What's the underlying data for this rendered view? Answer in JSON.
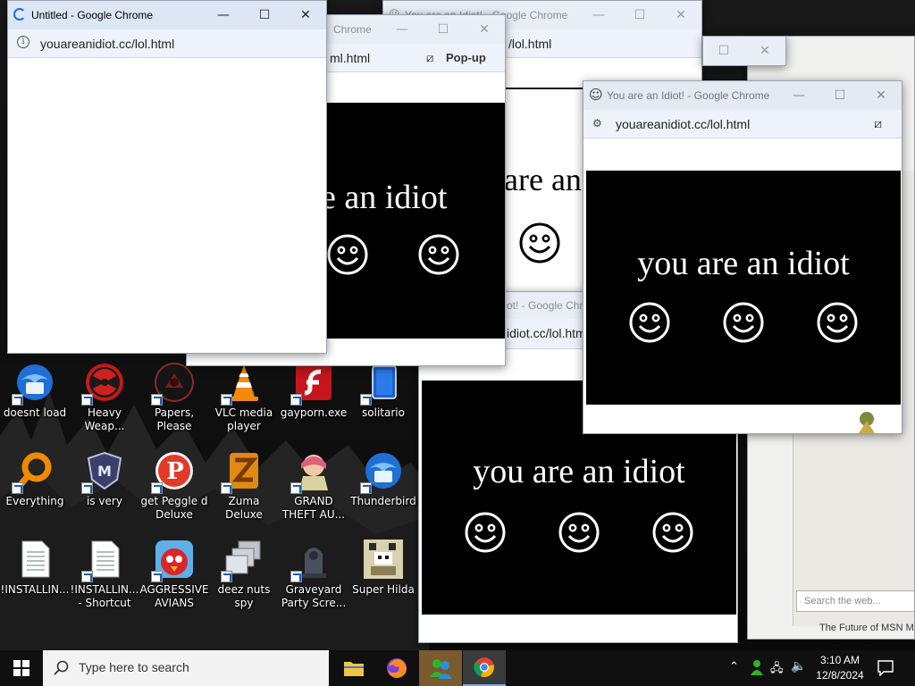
{
  "desktop": {
    "icons": [
      {
        "label": "doesnt load",
        "icon": "thunderbird-icon"
      },
      {
        "label": "Heavy Weap...",
        "icon": "radiation-icon"
      },
      {
        "label": "Papers, Please",
        "icon": "papers-please-icon"
      },
      {
        "label": "VLC media player",
        "icon": "vlc-cone-icon"
      },
      {
        "label": "gayporn.exe",
        "icon": "flash-icon"
      },
      {
        "label": "solitario",
        "icon": "solitaire-icon"
      },
      {
        "label": "Everything",
        "icon": "magnifier-icon"
      },
      {
        "label": "is very",
        "icon": "shield-icon"
      },
      {
        "label": "get Peggle d Deluxe",
        "icon": "peggle-icon"
      },
      {
        "label": "Zuma Deluxe",
        "icon": "zuma-icon"
      },
      {
        "label": "GRAND THEFT AU...",
        "icon": "anime-girl-icon"
      },
      {
        "label": "Thunderbird",
        "icon": "thunderbird-icon"
      },
      {
        "label": "!INSTALLIN...",
        "icon": "document-icon"
      },
      {
        "label": "!INSTALLIN... - Shortcut",
        "icon": "document-icon"
      },
      {
        "label": "AGGRESSIVE AVIANS",
        "icon": "angry-bird-icon"
      },
      {
        "label": "deez nuts spy",
        "icon": "windows-stack-icon"
      },
      {
        "label": "Graveyard Party Scre...",
        "icon": "graveyard-icon"
      },
      {
        "label": "Super Hilda",
        "icon": "pixel-character-icon"
      }
    ]
  },
  "windows": {
    "untitled": {
      "title": "Untitled - Google Chrome",
      "url": "youareanidiot.cc/lol.html"
    },
    "popup1": {
      "title_partial": "Chrome",
      "url_partial": "ml.html",
      "popup_label": "Pop-up",
      "text": "e an idiot"
    },
    "popup_back": {
      "title_partial": "You are an Idiot! - Google Chrome",
      "url_partial": "/lol.html"
    },
    "popup_mid": {
      "text": "are an"
    },
    "popup_front": {
      "title": "You are an Idiot! - Google Chrome",
      "url": "youareanidiot.cc/lol.html",
      "text": "you are an idiot"
    },
    "popup_lower": {
      "title_partial": "ot! - Google Chro",
      "url_partial": "idiot.cc/lol.htm",
      "text": "you are an idiot"
    },
    "msn": {
      "search_placeholder": "Search the web...",
      "footer": "The Future of MSN Me"
    }
  },
  "taskbar": {
    "search_text": "Type here to search",
    "time": "3:10 AM",
    "date": "12/8/2024"
  }
}
